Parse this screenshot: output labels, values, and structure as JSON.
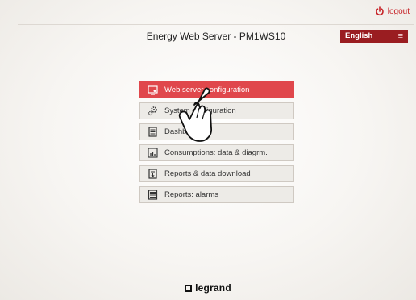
{
  "topbar": {
    "logout_label": "logout"
  },
  "header": {
    "title": "Energy Web Server - PM1WS10",
    "language": "English"
  },
  "menu": {
    "items": [
      {
        "label": "Web server configuration",
        "icon": "monitor-settings-icon"
      },
      {
        "label": "System configuration",
        "icon": "gears-icon"
      },
      {
        "label": "Dashboard",
        "icon": "dashboard-icon"
      },
      {
        "label": "Consumptions: data & diagrm.",
        "icon": "chart-icon"
      },
      {
        "label": "Reports & data download",
        "icon": "report-download-icon"
      },
      {
        "label": "Reports: alarms",
        "icon": "alarm-report-icon"
      }
    ]
  },
  "footer": {
    "brand": "legrand"
  },
  "colors": {
    "accent": "#e0474c",
    "brand": "#c62126",
    "lang_bg": "#9a1d21"
  }
}
